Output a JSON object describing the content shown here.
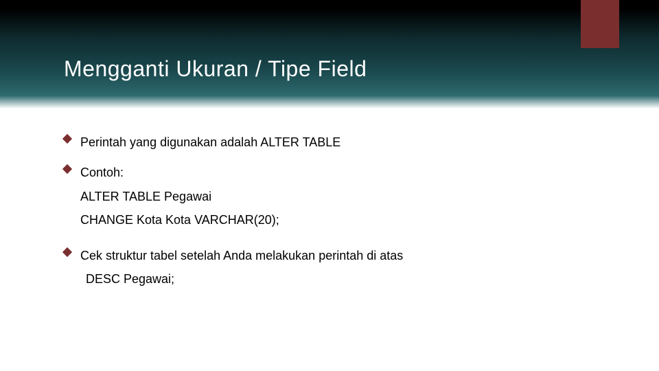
{
  "title": "Mengganti Ukuran / Tipe Field",
  "lines": {
    "b1": "Perintah yang digunakan adalah ALTER TABLE",
    "b2": "Contoh:",
    "c1": "ALTER TABLE Pegawai",
    "c2": "CHANGE Kota Kota VARCHAR(20);",
    "b3": "Cek struktur tabel setelah Anda melakukan perintah di atas",
    "c3": "DESC Pegawai;"
  }
}
